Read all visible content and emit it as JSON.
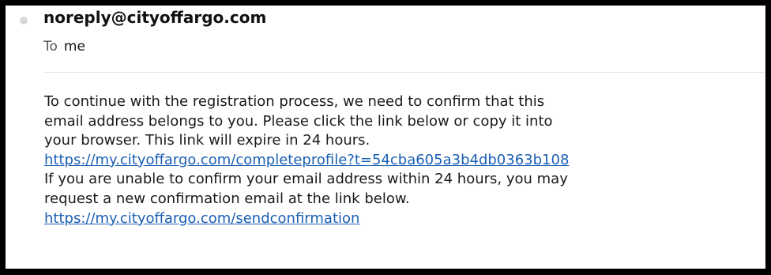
{
  "email": {
    "sender": "noreply@cityoffargo.com",
    "to_label": "To",
    "to_value": "me",
    "body_lines": [
      "To continue with the registration process, we need to confirm that this",
      "email address belongs to you.  Please click the link below or copy it into",
      "your browser.  This link will expire in 24 hours."
    ],
    "link_primary": "https://my.cityoffargo.com/completeprofile?t=54cba605a3b4db0363b108",
    "body_lines_2": [
      "If you are unable to confirm your email address within 24 hours, you may",
      "request a new confirmation email at the link below."
    ],
    "link_secondary": "https://my.cityoffargo.com/sendconfirmation"
  },
  "colors": {
    "link": "#1a5fb4",
    "border": "#000000",
    "unread_dot": "#d9d9d9"
  }
}
